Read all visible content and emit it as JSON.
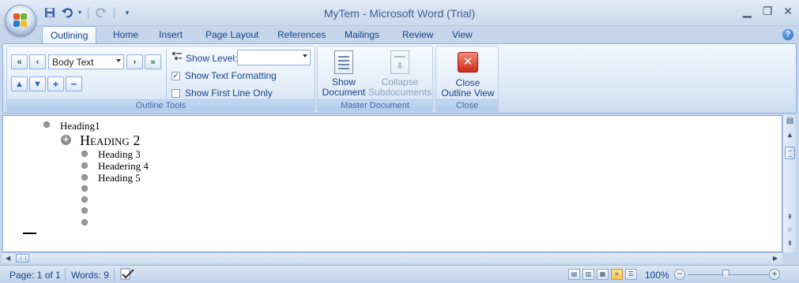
{
  "app": {
    "title": "MyTem - Microsoft Word (Trial)",
    "accent_color": "#15428b"
  },
  "quick_access": [
    {
      "name": "save-icon"
    },
    {
      "name": "undo-icon"
    },
    {
      "name": "redo-icon"
    },
    {
      "name": "customize-qat-icon"
    }
  ],
  "window_controls": {
    "minimize": "▬",
    "restore": "▭",
    "close": "✕"
  },
  "tabs": [
    {
      "label": "Outlining",
      "active": true
    },
    {
      "label": "Home"
    },
    {
      "label": "Insert"
    },
    {
      "label": "Page Layout"
    },
    {
      "label": "References"
    },
    {
      "label": "Mailings"
    },
    {
      "label": "Review"
    },
    {
      "label": "View"
    }
  ],
  "ribbon": {
    "outline_tools": {
      "label": "Outline Tools",
      "level_combo_value": "Body Text",
      "show_level_label": "Show Level:",
      "show_level_value": "",
      "show_text_formatting_label": "Show Text Formatting",
      "show_text_formatting_checked": true,
      "show_first_line_only_label": "Show First Line Only",
      "show_first_line_only_checked": false
    },
    "master_document": {
      "label": "Master Document",
      "show_document_label_1": "Show",
      "show_document_label_2": "Document",
      "collapse_subdocuments_label_1": "Collapse",
      "collapse_subdocuments_label_2": "Subdocuments"
    },
    "close": {
      "label": "Close",
      "close_outline_label_1": "Close",
      "close_outline_label_2": "Outline View"
    }
  },
  "document": {
    "heading1": "Heading1",
    "heading2": "Heading 2",
    "heading3": "Heading 3",
    "heading4": "Headering 4",
    "heading5": "Heading 5"
  },
  "status_bar": {
    "page": "Page: 1 of 1",
    "words": "Words: 9",
    "zoom": "100%"
  }
}
